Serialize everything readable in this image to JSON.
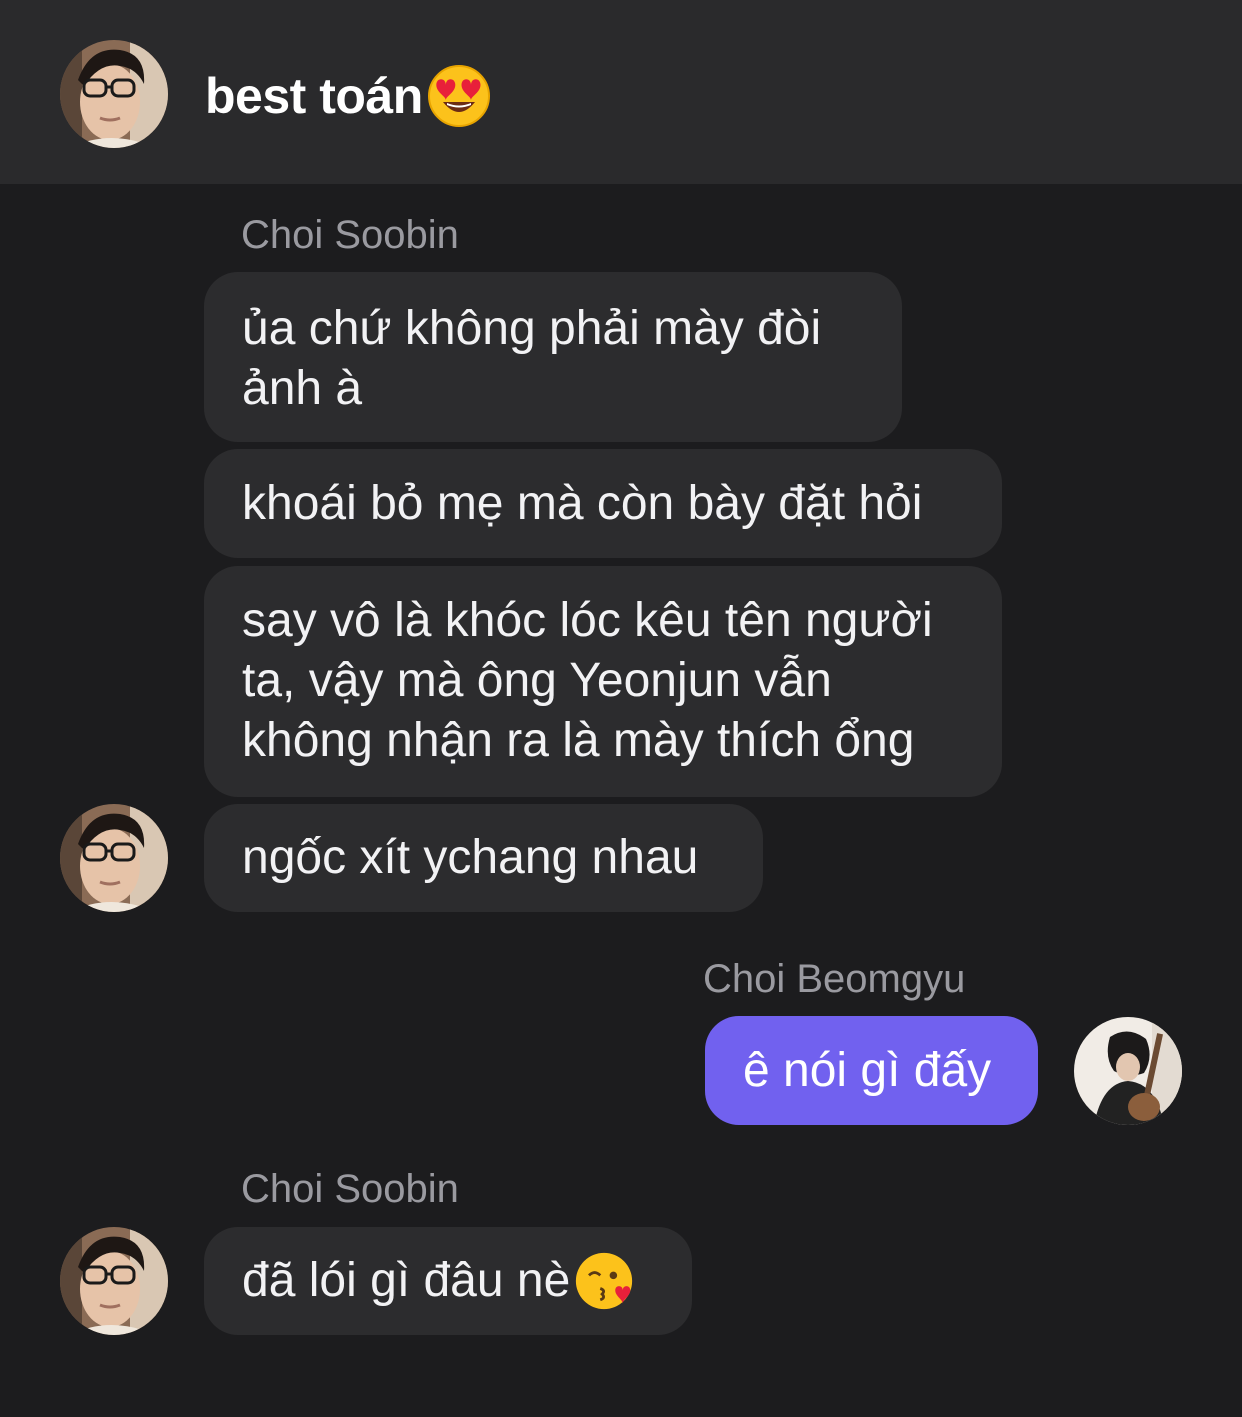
{
  "header": {
    "title": "best toán",
    "title_emoji": "heart-eyes-emoji",
    "avatar": "contact-avatar"
  },
  "colors": {
    "background": "#1c1c1e",
    "header_bg": "#2a2a2c",
    "incoming_bubble": "#2c2c2e",
    "outgoing_bubble": "#7161ef",
    "sender_name": "#9a9aa0"
  },
  "messages": {
    "group1": {
      "sender": "Choi Soobin",
      "m1": "ủa chứ không phải mày đòi ảnh à",
      "m2": "khoái bỏ mẹ mà còn bày đặt hỏi",
      "m3": "say vô là khóc lóc kêu tên người ta, vậy mà ông Yeonjun vẫn không nhận ra là mày thích ổng",
      "m4": "ngốc xít ychang nhau"
    },
    "group2": {
      "sender": "Choi Beomgyu",
      "m1": "ê nói gì đấy"
    },
    "group3": {
      "sender": "Choi Soobin",
      "m1": "đã lói gì đâu nè",
      "m1_emoji": "kissing-wink-emoji"
    }
  }
}
